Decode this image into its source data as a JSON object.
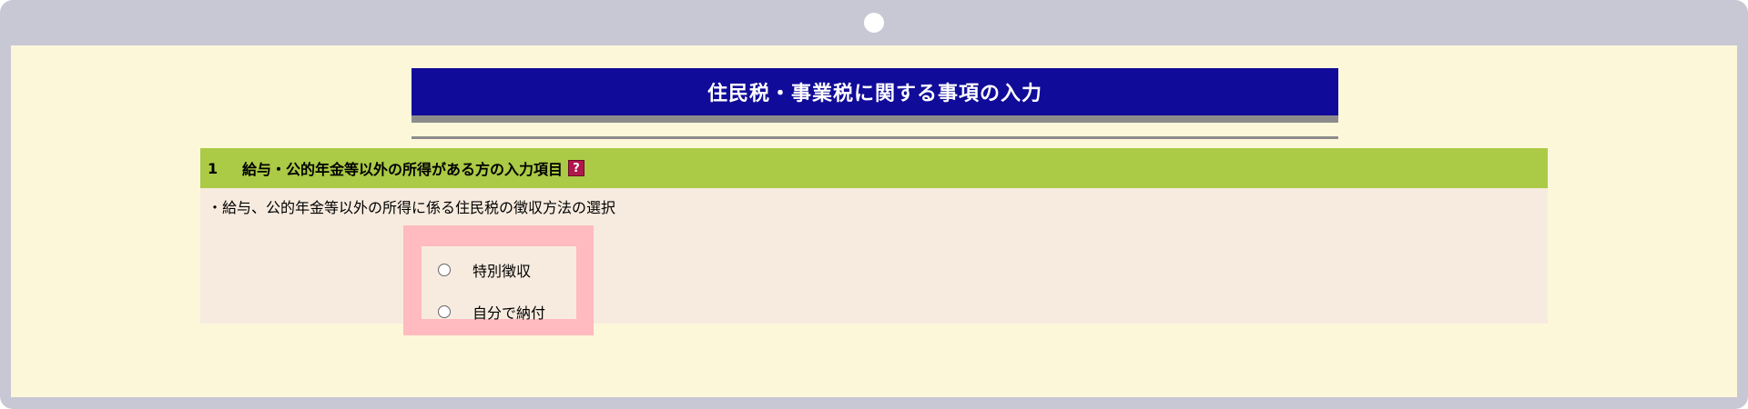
{
  "page": {
    "title": "住民税・事業税に関する事項の入力"
  },
  "section": {
    "number": "1",
    "title": "給与・公的年金等以外の所得がある方の入力項目",
    "help_icon": "help-question-icon",
    "help_glyph": "?"
  },
  "question": {
    "text": "・給与、公的年金等以外の所得に係る住民税の徴収方法の選択",
    "options": [
      {
        "label": "特別徴収",
        "selected": false
      },
      {
        "label": "自分で納付",
        "selected": false
      }
    ]
  },
  "colors": {
    "banner": "#110b99",
    "section_header": "#abca46",
    "highlight": "#ffbbbf",
    "background": "#fdf7da"
  }
}
